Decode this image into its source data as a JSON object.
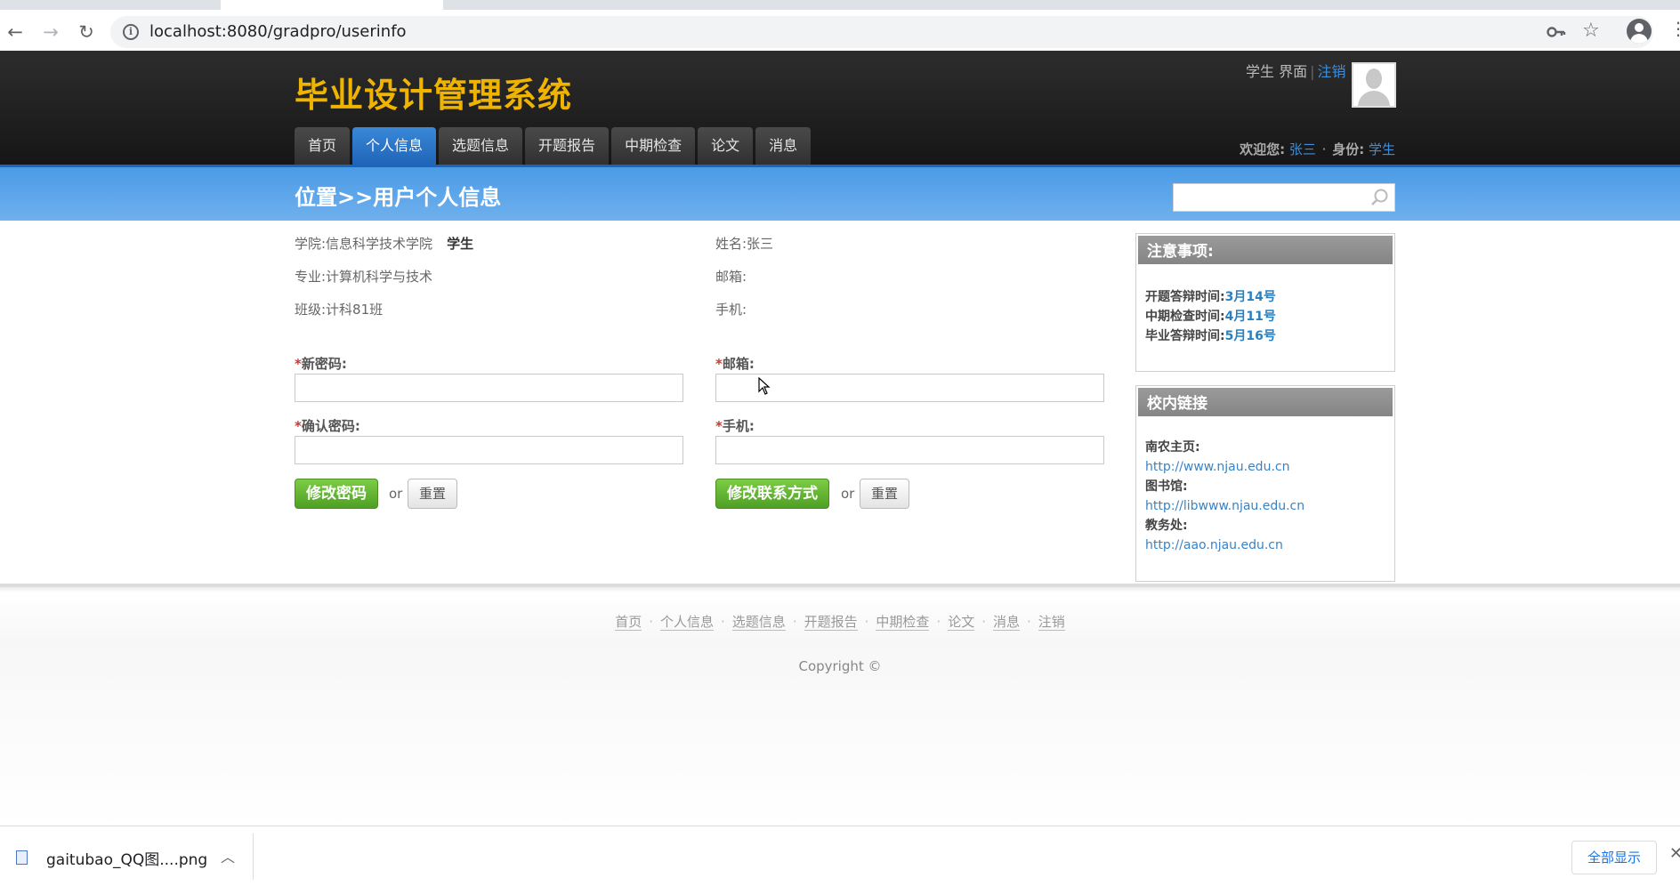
{
  "browser": {
    "url": "localhost:8080/gradpro/userinfo"
  },
  "header": {
    "site_title": "毕业设计管理系统",
    "top_links": {
      "role_page": "学生 界面",
      "sep": "|",
      "logout": "注销"
    },
    "nav": [
      {
        "label": "首页"
      },
      {
        "label": "个人信息"
      },
      {
        "label": "选题信息"
      },
      {
        "label": "开题报告"
      },
      {
        "label": "中期检查"
      },
      {
        "label": "论文"
      },
      {
        "label": "消息"
      }
    ],
    "welcome": {
      "prefix": "欢迎您:",
      "username": "张三",
      "dot": "·",
      "identity_label": "身份:",
      "identity": "学生"
    }
  },
  "band": {
    "breadcrumb": "位置>>用户个人信息",
    "search_placeholder": ""
  },
  "profile": {
    "college": "学院:信息科学技术学院",
    "role": "学生",
    "major": "专业:计算机科学与技术",
    "class": "班级:计科81班",
    "name": "姓名:张三",
    "email": "邮箱:",
    "phone": "手机:"
  },
  "password_form": {
    "req": "*",
    "new_label": "新密码:",
    "confirm_label": "确认密码:",
    "submit": "修改密码",
    "or": "or",
    "reset": "重置"
  },
  "contact_form": {
    "req": "*",
    "email_label": "邮箱:",
    "phone_label": "手机:",
    "submit": "修改联系方式",
    "or": "or",
    "reset": "重置"
  },
  "notice_panel": {
    "title": "注意事项:",
    "items": [
      {
        "label": "开题答辩时间:",
        "date": "3月14号"
      },
      {
        "label": "中期检查时间:",
        "date": "4月11号"
      },
      {
        "label": "毕业答辩时间:",
        "date": "5月16号"
      }
    ]
  },
  "links_panel": {
    "title": "校内链接",
    "items": [
      {
        "label": "南农主页:",
        "url": "http://www.njau.edu.cn"
      },
      {
        "label": "图书馆:",
        "url": "http://libwww.njau.edu.cn"
      },
      {
        "label": "教务处:",
        "url": "http://aao.njau.edu.cn"
      }
    ]
  },
  "footer": {
    "links": [
      {
        "label": "首页"
      },
      {
        "label": "个人信息"
      },
      {
        "label": "选题信息"
      },
      {
        "label": "开题报告"
      },
      {
        "label": "中期检查"
      },
      {
        "label": "论文"
      },
      {
        "label": "消息"
      },
      {
        "label": "注销"
      }
    ],
    "sep": "·",
    "copyright": "Copyright ©"
  },
  "download_bar": {
    "file_name": "gaitubao_QQ图....png",
    "show_all": "全部显示"
  }
}
